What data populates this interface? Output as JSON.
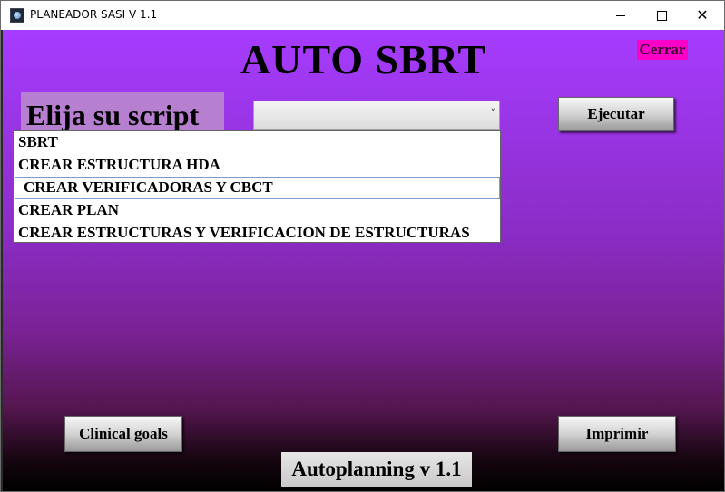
{
  "window": {
    "title": "PLANEADOR SASI V 1.1",
    "minimize_glyph": "",
    "maximize_glyph": "",
    "close_glyph": "✕"
  },
  "header": {
    "title": "AUTO SBRT",
    "close_label": "Cerrar"
  },
  "script_selector": {
    "label": "Elija su script",
    "value": "",
    "chevron": "˅",
    "options": [
      "SBRT",
      "CREAR ESTRUCTURA HDA",
      "CREAR VERIFICADORAS Y CBCT",
      "CREAR PLAN",
      "CREAR ESTRUCTURAS Y VERIFICACION DE ESTRUCTURAS"
    ],
    "highlighted_index": 2
  },
  "buttons": {
    "execute": "Ejecutar",
    "clinical_goals": "Clinical goals",
    "print": "Imprimir"
  },
  "footer": {
    "version": "Autoplanning v 1.1"
  },
  "colors": {
    "background_top": "#a63cff",
    "background_bottom": "#000000",
    "close_button": "#ff00c8",
    "label_bg": "#b77fcf"
  }
}
